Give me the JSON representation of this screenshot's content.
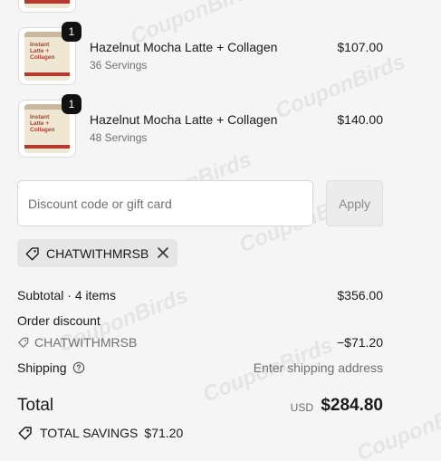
{
  "items": [
    {
      "quantity": "1",
      "title": "Hazelnut Mocha Latte + Collagen",
      "subtitle": "36 Servings",
      "price": "$107.00",
      "image": "instant-latte-collagen-pouch"
    },
    {
      "quantity": "1",
      "title": "Hazelnut Mocha Latte + Collagen",
      "subtitle": "48 Servings",
      "price": "$140.00",
      "image": "instant-latte-collagen-pouch"
    }
  ],
  "discount": {
    "placeholder": "Discount code or gift card",
    "apply_label": "Apply",
    "applied_code": "CHATWITHMRSB"
  },
  "summary": {
    "subtotal_label": "Subtotal · 4 items",
    "subtotal_value": "$356.00",
    "order_discount_label": "Order discount",
    "discount_code": "CHATWITHMRSB",
    "discount_value": "−$71.20",
    "shipping_label": "Shipping",
    "shipping_value": "Enter shipping address",
    "total_label": "Total",
    "total_currency": "USD",
    "total_value": "$284.80",
    "savings_label": "TOTAL SAVINGS",
    "savings_value": "$71.20"
  },
  "watermark": "CouponBirds",
  "colors": {
    "text": "#1a1a1a",
    "muted": "#707070",
    "background": "#f5f5f5",
    "badge": "#111111"
  }
}
